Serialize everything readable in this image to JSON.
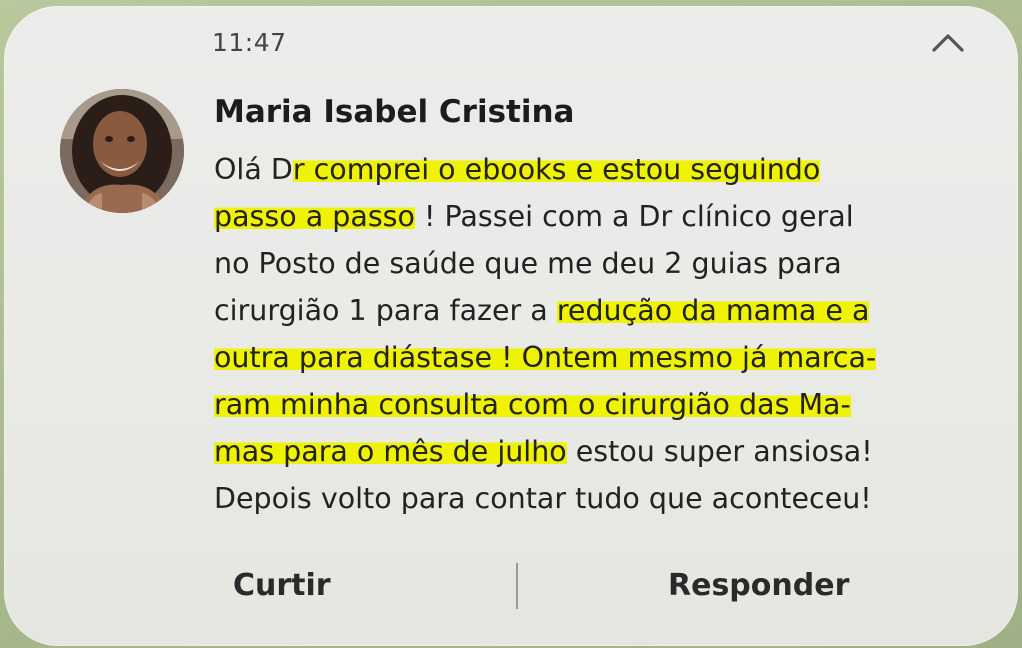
{
  "notification": {
    "time": "11:47",
    "sender": "Maria Isabel Cristina",
    "message_lines": [
      [
        {
          "text": "Olá D",
          "highlight": false
        },
        {
          "text": "r comprei o ebooks e estou seguindo",
          "highlight": true
        }
      ],
      [
        {
          "text": "passo a passo",
          "highlight": true
        },
        {
          "text": " ! Passei com a Dr clínico geral",
          "highlight": false
        }
      ],
      [
        {
          "text": "no Posto de saúde que me deu 2 guias para",
          "highlight": false
        }
      ],
      [
        {
          "text": "cirurgião 1 para fazer a ",
          "highlight": false
        },
        {
          "text": "redução da mama e a",
          "highlight": true
        }
      ],
      [
        {
          "text": "outra para diástase ! Ontem mesmo já marca-",
          "highlight": true
        }
      ],
      [
        {
          "text": "ram minha consulta com o cirurgião das Ma-",
          "highlight": true
        }
      ],
      [
        {
          "text": "mas para o mês de julho",
          "highlight": true
        },
        {
          "text": " estou super ansiosa!",
          "highlight": false
        }
      ],
      [
        {
          "text": "Depois volto para contar tudo que aconteceu!",
          "highlight": false
        }
      ]
    ],
    "actions": {
      "like_label": "Curtir",
      "reply_label": "Responder"
    },
    "icons": {
      "collapse": "chevron-up-icon"
    }
  },
  "colors": {
    "highlight": "#eff200",
    "card_background": "#eaebe7",
    "text": "#222222"
  }
}
